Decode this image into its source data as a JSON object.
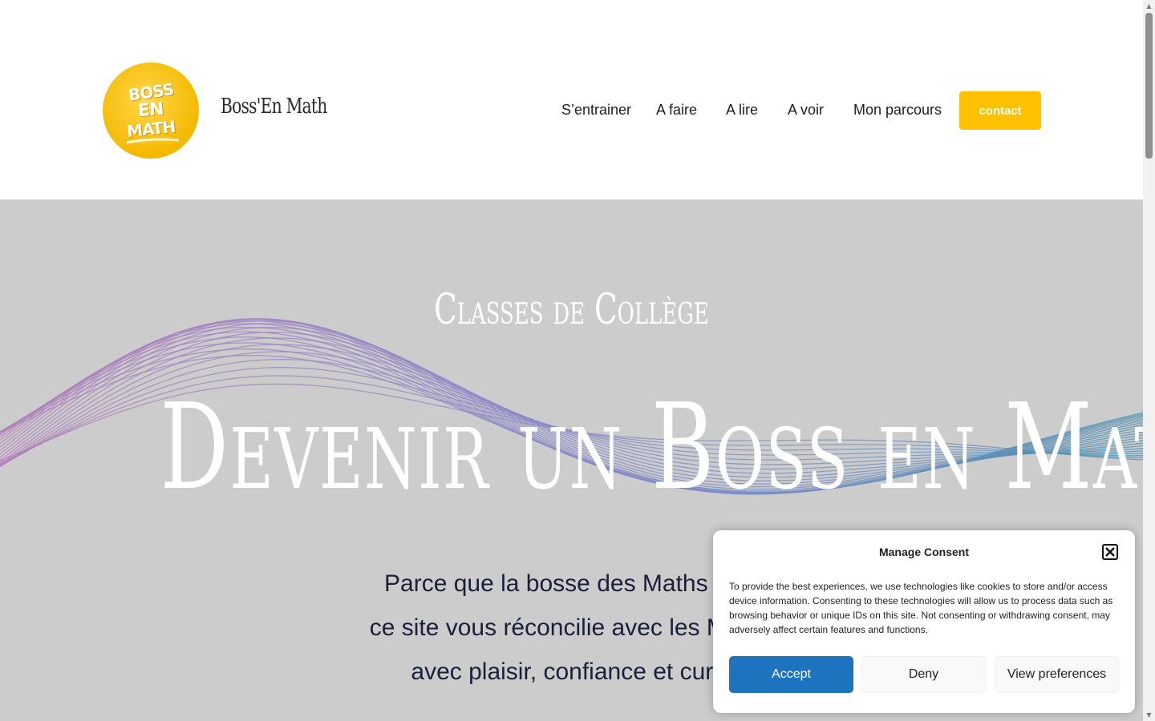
{
  "header": {
    "logo_lines": [
      "BOSS",
      "EN",
      "MATH"
    ],
    "site_title": "Boss'En Math",
    "nav": [
      {
        "label": "S’entrainer"
      },
      {
        "label": "A faire"
      },
      {
        "label": "A lire"
      },
      {
        "label": "A voir"
      },
      {
        "label": "Mon parcours"
      }
    ],
    "contact_label": "contact"
  },
  "hero": {
    "subtitle": "Classes de Collège",
    "title": "Devenir un Boss en Math",
    "text_lines": [
      "Parce que la bosse des Maths n’ex",
      "ce site vous réconcilie avec les Mathe",
      "avec plaisir, confiance et curio"
    ]
  },
  "consent": {
    "title": "Manage Consent",
    "body": "To provide the best experiences, we use technologies like cookies to store and/or access device information. Consenting to these technologies will allow us to process data such as browsing behavior or unique IDs on this site. Not consenting or withdrawing consent, may adversely affect certain features and functions.",
    "accept_label": "Accept",
    "deny_label": "Deny",
    "prefs_label": "View preferences"
  },
  "colors": {
    "accent": "#ffc100",
    "accept": "#1e73be",
    "hero_bg": "#cccccc"
  }
}
